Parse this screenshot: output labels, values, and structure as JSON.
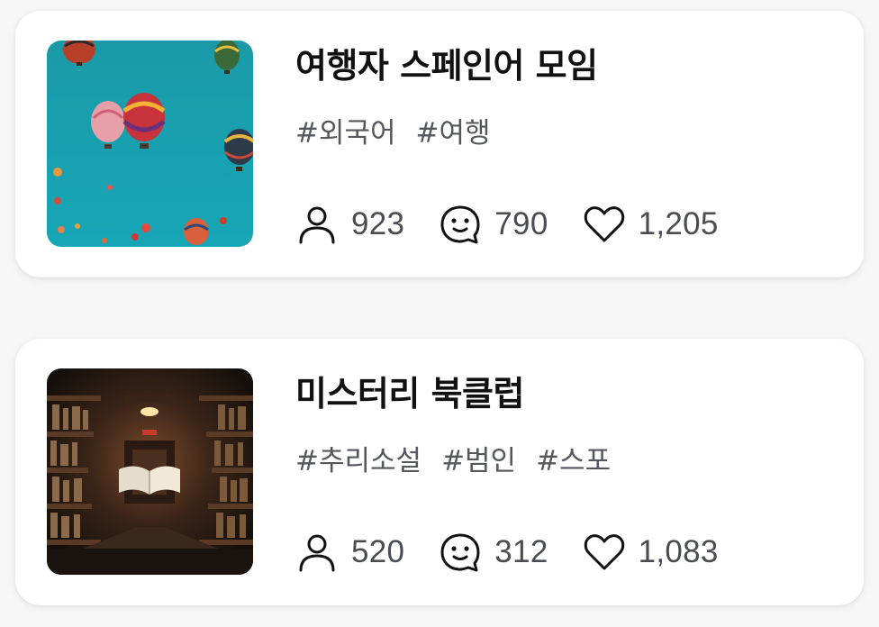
{
  "groups": [
    {
      "title": "여행자 스페인어 모임",
      "tags": [
        "#외국어",
        "#여행"
      ],
      "members": "923",
      "comments": "790",
      "likes": "1,205",
      "icons": {
        "members": "person-icon",
        "comments": "chat-bubble-icon",
        "likes": "heart-icon"
      }
    },
    {
      "title": "미스터리 북클럽",
      "tags": [
        "#추리소설",
        "#범인",
        "#스포"
      ],
      "members": "520",
      "comments": "312",
      "likes": "1,083",
      "icons": {
        "members": "person-icon",
        "comments": "chat-bubble-icon",
        "likes": "heart-icon"
      }
    }
  ],
  "colors": {
    "title": "#111111",
    "tag": "#55575c",
    "count": "#4a4c52",
    "card_bg": "#ffffff",
    "page_bg": "#f7f7f8"
  }
}
